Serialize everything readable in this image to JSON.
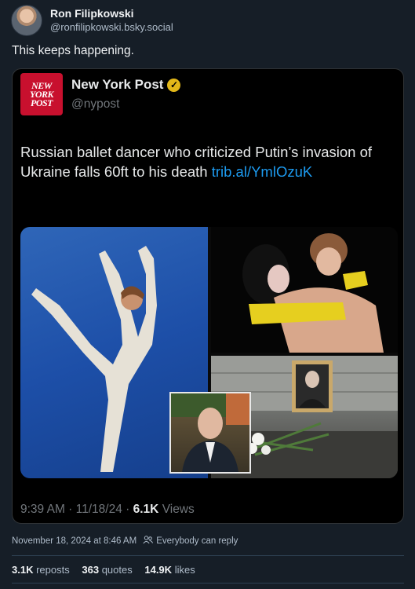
{
  "post": {
    "author_name": "Ron Filipkowski",
    "author_handle": "@ronfilipkowski.bsky.social",
    "text": "This keeps happening."
  },
  "embed": {
    "logo_lines": [
      "NEW",
      "YORK",
      "POST"
    ],
    "name": "New York Post",
    "handle": "@nypost",
    "text": "Russian ballet dancer who criticized Putin’s invasion of Ukraine falls 60ft to his death ",
    "link": "trib.al/YmlOzuK",
    "time": "9:39 AM",
    "date": "11/18/24",
    "views_count": "6.1K",
    "views_label": "Views",
    "verified_icon": "verified-check-icon"
  },
  "meta": {
    "timestamp": "November 18, 2024 at 8:46 AM",
    "reply_setting": "Everybody can reply",
    "reply_icon": "people-icon"
  },
  "stats": {
    "reposts_count": "3.1K",
    "reposts_label": "reposts",
    "quotes_count": "363",
    "quotes_label": "quotes",
    "likes_count": "14.9K",
    "likes_label": "likes"
  },
  "colors": {
    "background": "#161e27",
    "link": "#1d9bf0",
    "nyp_red": "#c8102e",
    "verified_gold": "#e2b719"
  }
}
